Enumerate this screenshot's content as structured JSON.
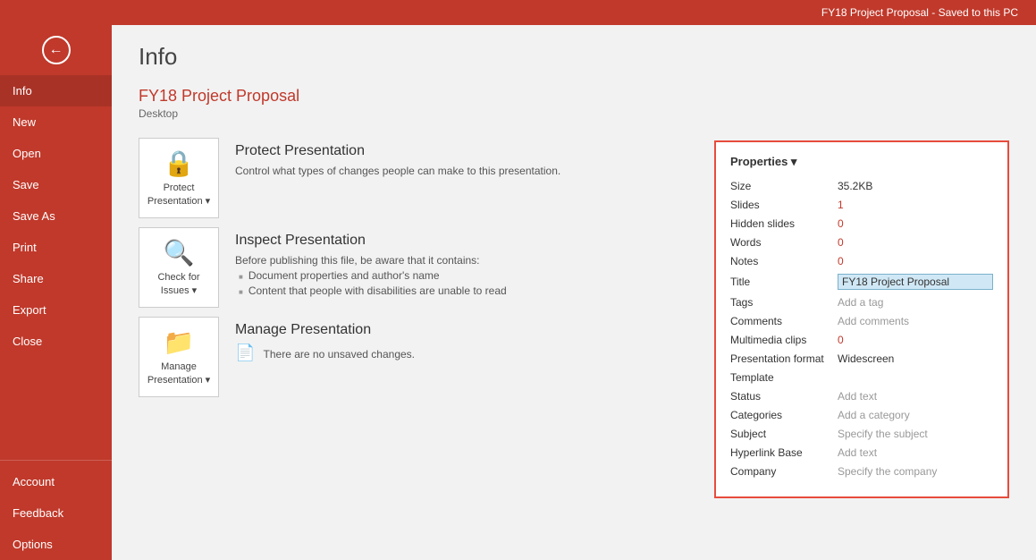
{
  "topbar": {
    "title": "FY18 Project Proposal  -  Saved to this PC"
  },
  "sidebar": {
    "back_icon": "←",
    "items": [
      {
        "id": "info",
        "label": "Info",
        "active": true
      },
      {
        "id": "new",
        "label": "New"
      },
      {
        "id": "open",
        "label": "Open"
      },
      {
        "id": "save",
        "label": "Save"
      },
      {
        "id": "save-as",
        "label": "Save As"
      },
      {
        "id": "print",
        "label": "Print"
      },
      {
        "id": "share",
        "label": "Share"
      },
      {
        "id": "export",
        "label": "Export"
      },
      {
        "id": "close",
        "label": "Close"
      }
    ],
    "bottom_items": [
      {
        "id": "account",
        "label": "Account"
      },
      {
        "id": "feedback",
        "label": "Feedback"
      },
      {
        "id": "options",
        "label": "Options"
      }
    ]
  },
  "page": {
    "title": "Info",
    "file_title": "FY18 Project Proposal",
    "file_location": "Desktop"
  },
  "cards": [
    {
      "id": "protect",
      "icon": "🔒",
      "icon_label": "Protect\nPresentation ▾",
      "heading": "Protect Presentation",
      "desc": "Control what types of changes people can make to this presentation.",
      "list": []
    },
    {
      "id": "check",
      "icon": "🔍",
      "icon_label": "Check for\nIssues ▾",
      "heading": "Inspect Presentation",
      "desc": "Before publishing this file, be aware that it contains:",
      "list": [
        "Document properties and author's name",
        "Content that people with disabilities are unable to read"
      ]
    },
    {
      "id": "manage",
      "icon": "📁",
      "icon_label": "Manage\nPresentation ▾",
      "heading": "Manage Presentation",
      "desc": "",
      "unsaved": "There are no unsaved changes."
    }
  ],
  "properties": {
    "title": "Properties ▾",
    "rows": [
      {
        "label": "Size",
        "value": "35.2KB",
        "style": "black"
      },
      {
        "label": "Slides",
        "value": "1",
        "style": "orange"
      },
      {
        "label": "Hidden slides",
        "value": "0",
        "style": "orange"
      },
      {
        "label": "Words",
        "value": "0",
        "style": "orange"
      },
      {
        "label": "Notes",
        "value": "0",
        "style": "orange"
      },
      {
        "label": "Title",
        "value": "FY18 Project Proposal",
        "style": "highlighted"
      },
      {
        "label": "Tags",
        "value": "Add a tag",
        "style": "gray"
      },
      {
        "label": "Comments",
        "value": "Add comments",
        "style": "gray"
      },
      {
        "label": "Multimedia clips",
        "value": "0",
        "style": "orange"
      },
      {
        "label": "Presentation format",
        "value": "Widescreen",
        "style": "black"
      },
      {
        "label": "Template",
        "value": "",
        "style": "black"
      },
      {
        "label": "Status",
        "value": "Add text",
        "style": "gray"
      },
      {
        "label": "Categories",
        "value": "Add a category",
        "style": "gray"
      },
      {
        "label": "Subject",
        "value": "Specify the subject",
        "style": "gray"
      },
      {
        "label": "Hyperlink Base",
        "value": "Add text",
        "style": "gray"
      },
      {
        "label": "Company",
        "value": "Specify the company",
        "style": "gray"
      }
    ]
  }
}
